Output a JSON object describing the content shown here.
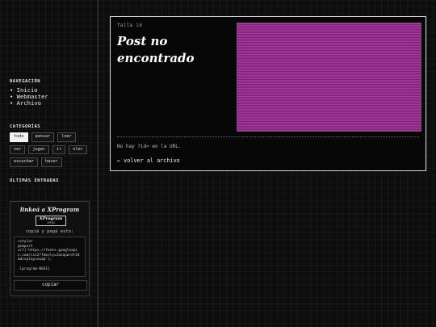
{
  "sidebar": {
    "nav_title": "NAVEGACIÓN",
    "nav_items": [
      "Inicio",
      "Webmaster",
      "Archivo"
    ],
    "categories_title": "CATEGORÍAS",
    "tags": [
      "todo",
      "pensar",
      "leer",
      "ver",
      "jugar",
      "ir",
      "oler",
      "escuchar",
      "hacer"
    ],
    "active_tag": "todo",
    "latest_title": "ÚLTIMAS ENTRADAS"
  },
  "link_box": {
    "title": "linkeá a XProgram",
    "badge_main": "XProgram",
    "badge_sub": "XPROG",
    "copy_label": "copiá y pegá esto:",
    "code": "<style>\n@import\nurl('https://fonts.googleapis.com/css2?family=Jacquard+24&display=swap');\n\n.lprogram-0031{",
    "copy_button": "copiar"
  },
  "post": {
    "meta": "falta id",
    "title": "Post no encontrado",
    "error": "No hay ?id= en la URL.",
    "back": "← volver al archivo"
  },
  "colors": {
    "accent": "#a93aa0",
    "accent_dark": "#7e2178",
    "background": "#0d0d0d",
    "border": "#d9d9d9"
  }
}
